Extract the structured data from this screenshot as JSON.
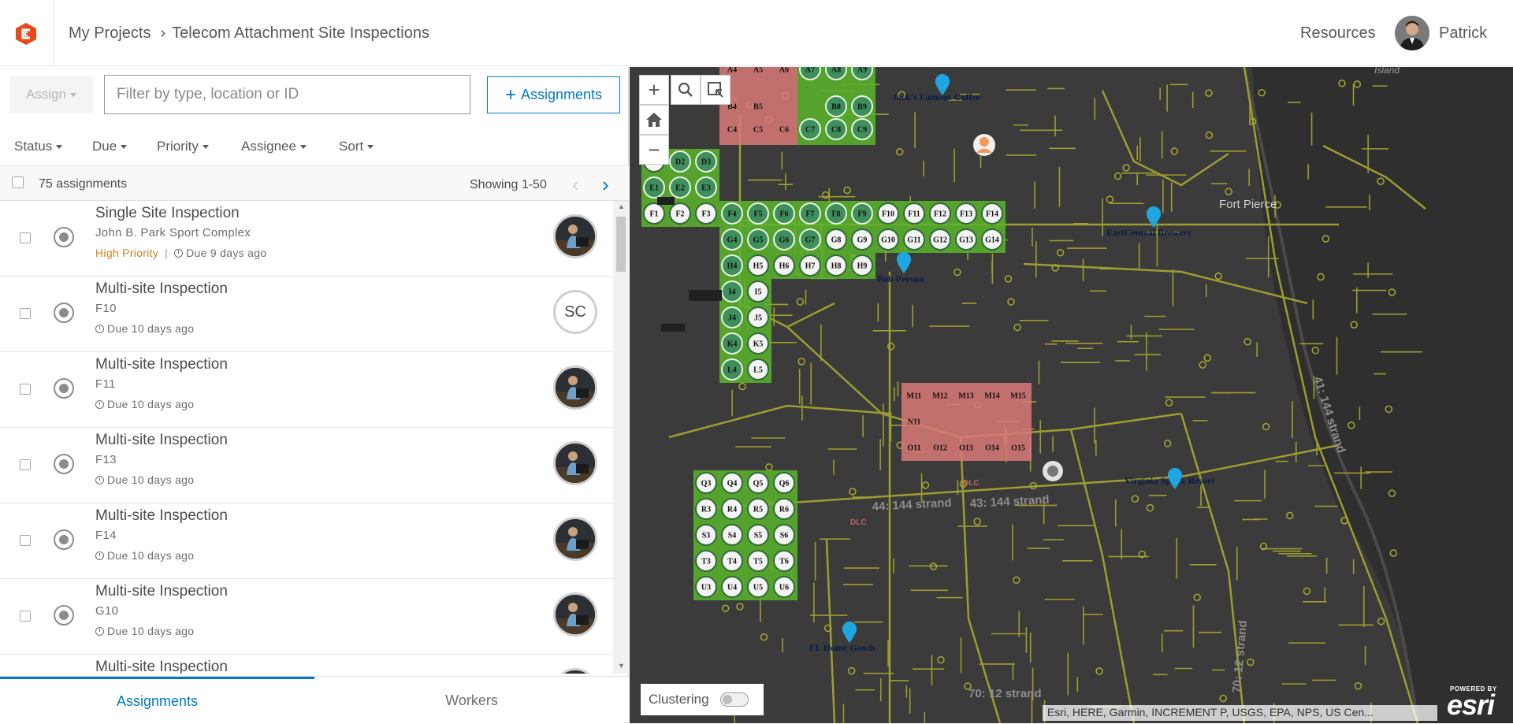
{
  "header": {
    "breadcrumb": [
      "My Projects",
      "Telecom Attachment Site Inspections"
    ],
    "breadcrumb_separator": "›",
    "resources_label": "Resources",
    "user_name": "Patrick"
  },
  "toolbar": {
    "assign_label": "Assign",
    "filter_placeholder": "Filter by type, location or ID",
    "new_assignments_label": "Assignments"
  },
  "filters": [
    "Status",
    "Due",
    "Priority",
    "Assignee",
    "Sort"
  ],
  "list_header": {
    "count_label": "75 assignments",
    "showing_label": "Showing 1-50"
  },
  "assignments": [
    {
      "title": "Single Site Inspection",
      "location": "John B. Park Sport Complex",
      "priority": "High Priority",
      "due": "Due 9 days ago",
      "assignee": "photo"
    },
    {
      "title": "Multi-site Inspection",
      "location": "F10",
      "priority": "",
      "due": "Due 10 days ago",
      "assignee": "SC"
    },
    {
      "title": "Multi-site Inspection",
      "location": "F11",
      "priority": "",
      "due": "Due 10 days ago",
      "assignee": "photo"
    },
    {
      "title": "Multi-site Inspection",
      "location": "F13",
      "priority": "",
      "due": "Due 10 days ago",
      "assignee": "photo"
    },
    {
      "title": "Multi-site Inspection",
      "location": "F14",
      "priority": "",
      "due": "Due 10 days ago",
      "assignee": "photo"
    },
    {
      "title": "Multi-site Inspection",
      "location": "G10",
      "priority": "",
      "due": "Due 10 days ago",
      "assignee": "photo"
    },
    {
      "title": "Multi-site Inspection",
      "location": "",
      "priority": "",
      "due": "",
      "assignee": "photo"
    }
  ],
  "tabs": {
    "assignments": "Assignments",
    "workers": "Workers"
  },
  "map": {
    "places": {
      "jacks": "Jack's Famous Coffee",
      "eastcentral": "EastCentral Brewery",
      "bob": "Bob Persun",
      "virginia": "Virginia Spa & Resort",
      "fl_home": "FL Home Goods",
      "fort_pierce": "Fort Pierce",
      "island": "Island"
    },
    "road_labels": {
      "strand_44": "44: 144 strand",
      "strand_43": "43: 144 strand",
      "strand_41": "41: 144 strand",
      "strand_70a": "70: 12 strand",
      "strand_70b": "70: 12 strand",
      "dlc1": "DLC",
      "dlc2": "DLC"
    },
    "clustering_label": "Clustering",
    "attribution": "Esri, HERE, Garmin, INCREMENT P, USGS, EPA, NPS, US Cen...",
    "esri_powered": "POWERED BY",
    "esri_word": "esri",
    "grid_labels": {
      "A": [
        "A4",
        "A5",
        "A6",
        "A7",
        "A8",
        "A9"
      ],
      "B": [
        "B4",
        "B5",
        "B8",
        "B9"
      ],
      "C": [
        "C4",
        "C5",
        "C6",
        "C7",
        "C8",
        "C9"
      ],
      "D": [
        "D1",
        "D2",
        "D3"
      ],
      "E": [
        "E1",
        "E2",
        "E3"
      ],
      "F": [
        "F1",
        "F2",
        "F3",
        "F4",
        "F5",
        "F6",
        "F7",
        "F8",
        "F9",
        "F10",
        "F11",
        "F12",
        "F13",
        "F14"
      ],
      "G": [
        "G4",
        "G5",
        "G6",
        "G7",
        "G8",
        "G9",
        "G10",
        "G11",
        "G12",
        "G13",
        "G14"
      ],
      "H": [
        "H4",
        "H5",
        "H6",
        "H7",
        "H8",
        "H9"
      ],
      "I": [
        "I4",
        "I5"
      ],
      "J": [
        "J4",
        "J5"
      ],
      "K": [
        "K4",
        "K5"
      ],
      "L": [
        "L4",
        "L5"
      ],
      "M": [
        "M11",
        "M12",
        "M13",
        "M14",
        "M15"
      ],
      "N": [
        "N11"
      ],
      "O": [
        "O11",
        "O12",
        "O13",
        "O14",
        "O15"
      ],
      "Q": [
        "Q3",
        "Q4",
        "Q5",
        "Q6"
      ],
      "R": [
        "R3",
        "R4",
        "R5",
        "R6"
      ],
      "S": [
        "S3",
        "S4",
        "S5",
        "S6"
      ],
      "T": [
        "T3",
        "T4",
        "T5",
        "T6"
      ],
      "U": [
        "U3",
        "U4",
        "U5",
        "U6"
      ]
    }
  },
  "colors": {
    "accent": "#0079c1",
    "priority_high": "#d17e21",
    "map_background": "#3b3b3b",
    "network_lines": "#a9a82f",
    "grid_green": "#5bb52c",
    "grid_red": "#d97a78",
    "grid_circle_dark": "#3f8f5c",
    "pin_blue": "#1fa6e0"
  },
  "icons": {
    "logo": "app-logo-icon",
    "caret": "caret-down-icon",
    "clock": "clock-icon",
    "status": "status-ring-icon",
    "zoom_in": "plus-icon",
    "zoom_out": "minus-icon",
    "home": "home-icon",
    "search": "search-icon",
    "select": "select-area-icon"
  }
}
